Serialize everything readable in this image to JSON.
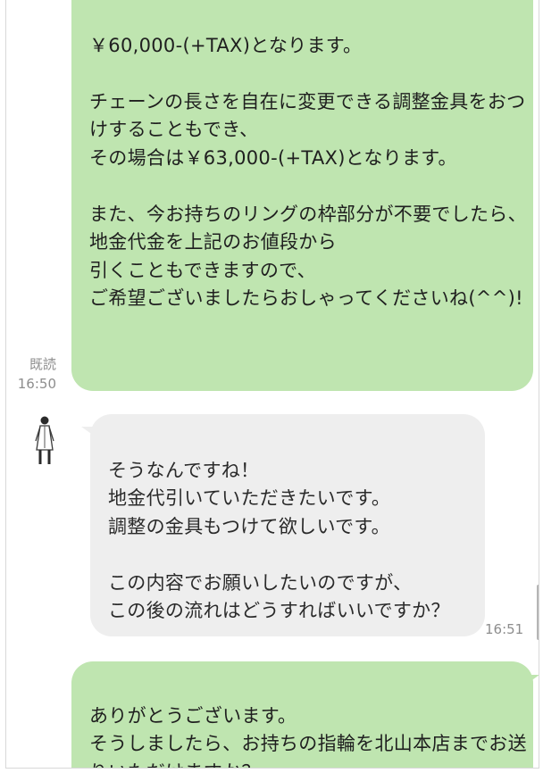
{
  "chat": {
    "messages": [
      {
        "sender": "self",
        "text": "￥60,000-(+TAX)となります。\n\nチェーンの長さを自在に変更できる調整金具をおつけすることもでき、\nその場合は￥63,000-(+TAX)となります。\n\nまた、今お持ちのリングの枠部分が不要でしたら、\n地金代金を上記のお値段から\n引くこともできますので、\nご希望ございましたらおしゃってくださいね(^^)!",
        "read_status": "既読",
        "time": "16:50"
      },
      {
        "sender": "other",
        "avatar_icon": "person-in-coat-icon",
        "text": "そうなんですね！\n地金代引いていただきたいです。\n調整の金具もつけて欲しいです。\n\nこの内容でお願いしたいのですが、\nこの後の流れはどうすればいいですか？",
        "time": "16:51"
      },
      {
        "sender": "self",
        "text": "ありがとうございます。\nそうしましたら、お持ちの指輪を北山本店までお送りいただけますか？"
      }
    ]
  },
  "colors": {
    "outgoing_bubble": "#bfe5b0",
    "incoming_bubble": "#eeeeee",
    "meta_text": "#8d8d8d"
  }
}
